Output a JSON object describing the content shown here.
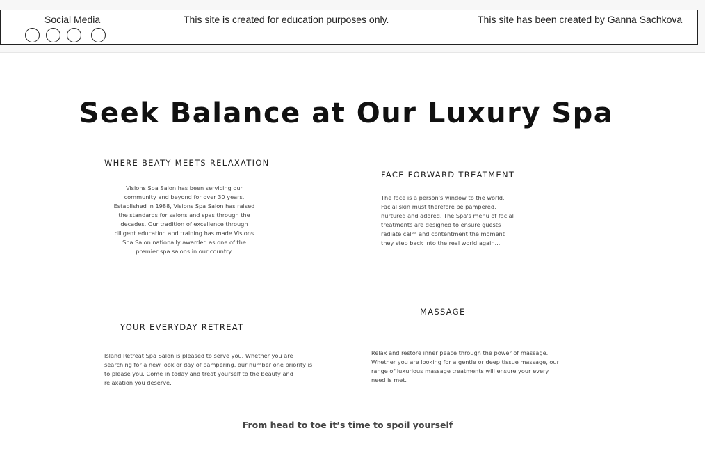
{
  "footer": {
    "social_title": "Social Media",
    "social_icons": [
      "social-icon-1",
      "social-icon-2",
      "social-icon-3",
      "social-icon-4"
    ],
    "education_notice": "This site is created for education purposes only.",
    "credit": "This site has been created by Ganna Sachkova"
  },
  "main": {
    "title": "Seek Balance at Our Luxury Spa",
    "sections": [
      {
        "heading": "WHERE BEATY MEETS RELAXATION",
        "body": "Visions Spa Salon has been servicing our community and beyond for over 30 years. Established in 1988, Visions Spa Salon has raised the standards for salons and spas through the decades. Our tradition of excellence through diligent education and training has made Visions Spa Salon nationally awarded as one of the premier spa salons in our country."
      },
      {
        "heading": "FACE FORWARD TREATMENT",
        "body": "The face is a person's window to the world. Facial skin must therefore be pampered, nurtured and adored. The Spa's menu of facial treatments are designed to ensure guests radiate calm and contentment the moment they step back into the real world again..."
      },
      {
        "heading": "YOUR EVERYDAY RETREAT",
        "body": "Island Retreat Spa Salon is pleased to serve you. Whether you are searching for a new look or day of pampering, our number one priority is to please you. Come in today and treat yourself to the beauty and relaxation you deserve."
      },
      {
        "heading": "MASSAGE",
        "body": "Relax and restore inner peace through the power of massage. Whether you are looking for a gentle or deep tissue massage, our range of luxurious massage treatments will ensure your every need is met."
      }
    ],
    "closing": "From head to toe it’s time to spoil yourself"
  },
  "colors": {
    "text": "#222222",
    "body_text": "#444444",
    "border": "#222222",
    "topbar_bg": "#f7f7f7"
  }
}
